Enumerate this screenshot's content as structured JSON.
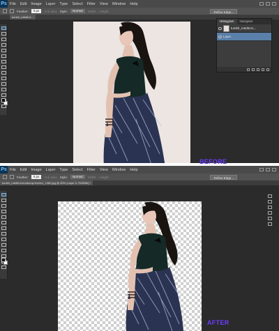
{
  "top_window": {
    "app_logo": "Ps",
    "menu": [
      "File",
      "Edit",
      "Image",
      "Layer",
      "Type",
      "Select",
      "Filter",
      "View",
      "Window",
      "Help"
    ],
    "options": {
      "feather_label": "Feather:",
      "feather_value": "0 px",
      "anti_alias": "Anti-alias",
      "style_label": "Style:",
      "style_value": "Normal",
      "width_label": "Width:",
      "height_label": "Height:",
      "refine_edge": "Refine Edge..."
    },
    "document_tab": "tumblr_m6d6n1...",
    "layers_panel": {
      "tabs": [
        "Histogram",
        "Navigator"
      ],
      "rows": [
        {
          "name": "tumblr_m6d6m1..."
        },
        {
          "name": "Layer"
        }
      ]
    }
  },
  "bottom_window": {
    "app_logo": "Ps",
    "menu": [
      "File",
      "Edit",
      "Image",
      "Layer",
      "Type",
      "Select",
      "Filter",
      "View",
      "Window",
      "Help"
    ],
    "options": {
      "feather_label": "Feather:",
      "feather_value": "0 px",
      "anti_alias": "Anti-alias",
      "style_label": "Style:",
      "style_value": "Normal",
      "width_label": "Width:",
      "height_label": "Height:",
      "refine_edge": "Refine Edge..."
    },
    "document_tab": "tumblr_m6d6n1w1o8a1qc1he0o1_1280.jpg @ 50% (Layer 0, RGB/8#) *"
  },
  "labels": {
    "before": "BEFORE",
    "after": "AFTER"
  },
  "colors": {
    "label": "#6b3dff",
    "workspace": "#2b2b2b",
    "menubar": "#4a4a4a",
    "selected_layer": "#5a7fa8"
  }
}
